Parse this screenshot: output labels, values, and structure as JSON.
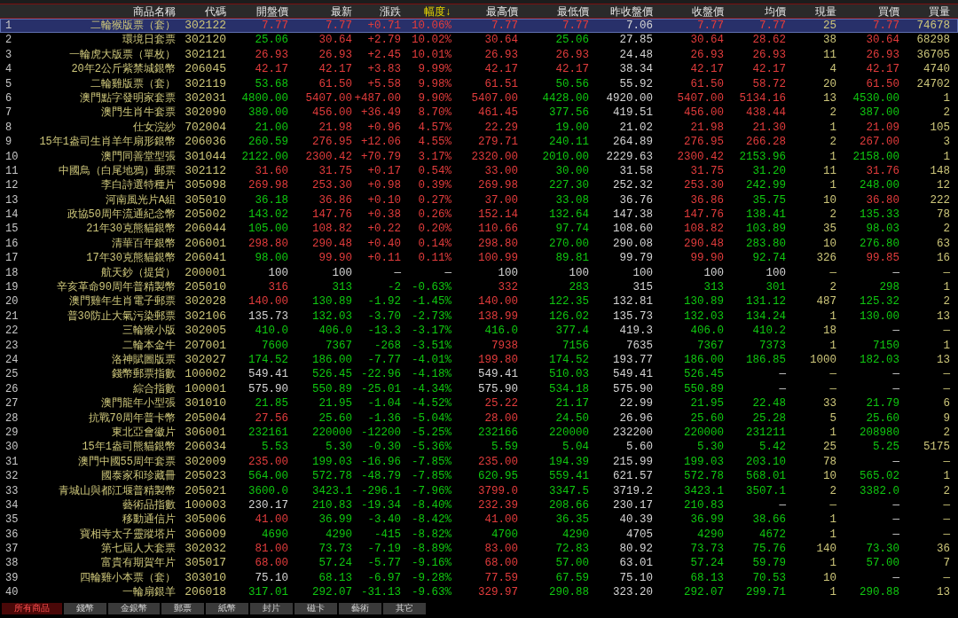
{
  "columns": [
    {
      "label": "商品名稱",
      "sorted": false
    },
    {
      "label": "代碼",
      "sorted": false
    },
    {
      "label": "開盤價",
      "sorted": false
    },
    {
      "label": "最新",
      "sorted": false
    },
    {
      "label": "漲跌",
      "sorted": false
    },
    {
      "label": "幅度↓",
      "sorted": true
    },
    {
      "label": "最高價",
      "sorted": false
    },
    {
      "label": "最低價",
      "sorted": false
    },
    {
      "label": "昨收盤價",
      "sorted": false
    },
    {
      "label": "收盤價",
      "sorted": false
    },
    {
      "label": "均價",
      "sorted": false
    },
    {
      "label": "現量",
      "sorted": false
    },
    {
      "label": "買價",
      "sorted": false
    },
    {
      "label": "買量",
      "sorted": false
    }
  ],
  "rows": [
    {
      "no": "1",
      "name": "二輪猴版票（套）",
      "code": "302122",
      "selected": true,
      "values": [
        "7.77",
        "7.77",
        "+0.71",
        "10.06%",
        "7.77",
        "7.77",
        "7.06",
        "7.77",
        "7.77",
        "25",
        "7.77",
        "74678"
      ]
    },
    {
      "no": "2",
      "name": "環境日套票",
      "code": "302120",
      "selected": false,
      "values": [
        "25.06",
        "30.64",
        "+2.79",
        "10.02%",
        "30.64",
        "25.06",
        "27.85",
        "30.64",
        "28.62",
        "38",
        "30.64",
        "68298"
      ]
    },
    {
      "no": "3",
      "name": "一輪虎大版票（單枚）",
      "code": "302121",
      "selected": false,
      "values": [
        "26.93",
        "26.93",
        "+2.45",
        "10.01%",
        "26.93",
        "26.93",
        "24.48",
        "26.93",
        "26.93",
        "11",
        "26.93",
        "36705"
      ]
    },
    {
      "no": "4",
      "name": "20年2公斤紫禁城銀幣",
      "code": "206045",
      "selected": false,
      "values": [
        "42.17",
        "42.17",
        "+3.83",
        "9.99%",
        "42.17",
        "42.17",
        "38.34",
        "42.17",
        "42.17",
        "4",
        "42.17",
        "4740"
      ]
    },
    {
      "no": "5",
      "name": "二輪雞版票（套）",
      "code": "302119",
      "selected": false,
      "values": [
        "53.68",
        "61.50",
        "+5.58",
        "9.98%",
        "61.51",
        "50.56",
        "55.92",
        "61.50",
        "58.72",
        "20",
        "61.50",
        "24702"
      ]
    },
    {
      "no": "6",
      "name": "澳門點字發明家套票",
      "code": "302031",
      "selected": false,
      "values": [
        "4800.00",
        "5407.00",
        "+487.00",
        "9.90%",
        "5407.00",
        "4428.00",
        "4920.00",
        "5407.00",
        "5134.16",
        "13",
        "4530.00",
        "1"
      ]
    },
    {
      "no": "7",
      "name": "澳門生肖牛套票",
      "code": "302090",
      "selected": false,
      "values": [
        "380.00",
        "456.00",
        "+36.49",
        "8.70%",
        "461.45",
        "377.56",
        "419.51",
        "456.00",
        "438.44",
        "2",
        "387.00",
        "2"
      ]
    },
    {
      "no": "8",
      "name": "仕女浣紗",
      "code": "702004",
      "selected": false,
      "values": [
        "21.00",
        "21.98",
        "+0.96",
        "4.57%",
        "22.29",
        "19.00",
        "21.02",
        "21.98",
        "21.30",
        "1",
        "21.09",
        "105"
      ]
    },
    {
      "no": "9",
      "name": "15年1盎司生肖羊年扇形銀幣",
      "code": "206036",
      "selected": false,
      "values": [
        "260.59",
        "276.95",
        "+12.06",
        "4.55%",
        "279.71",
        "240.11",
        "264.89",
        "276.95",
        "266.28",
        "2",
        "267.00",
        "3"
      ]
    },
    {
      "no": "10",
      "name": "澳門同善堂型張",
      "code": "301044",
      "selected": false,
      "values": [
        "2122.00",
        "2300.42",
        "+70.79",
        "3.17%",
        "2320.00",
        "2010.00",
        "2229.63",
        "2300.42",
        "2153.96",
        "1",
        "2158.00",
        "1"
      ]
    },
    {
      "no": "11",
      "name": "中國鳥（白尾地鴉）郵票",
      "code": "302112",
      "selected": false,
      "values": [
        "31.60",
        "31.75",
        "+0.17",
        "0.54%",
        "33.00",
        "30.00",
        "31.58",
        "31.75",
        "31.20",
        "11",
        "31.76",
        "148"
      ]
    },
    {
      "no": "12",
      "name": "李白詩選特種片",
      "code": "305098",
      "selected": false,
      "values": [
        "269.98",
        "253.30",
        "+0.98",
        "0.39%",
        "269.98",
        "227.30",
        "252.32",
        "253.30",
        "242.99",
        "1",
        "248.00",
        "12"
      ]
    },
    {
      "no": "13",
      "name": "河南風光片A組",
      "code": "305010",
      "selected": false,
      "values": [
        "36.18",
        "36.86",
        "+0.10",
        "0.27%",
        "37.00",
        "33.08",
        "36.76",
        "36.86",
        "35.75",
        "10",
        "36.80",
        "222"
      ]
    },
    {
      "no": "14",
      "name": "政協50周年流通紀念幣",
      "code": "205002",
      "selected": false,
      "values": [
        "143.02",
        "147.76",
        "+0.38",
        "0.26%",
        "152.14",
        "132.64",
        "147.38",
        "147.76",
        "138.41",
        "2",
        "135.33",
        "78"
      ]
    },
    {
      "no": "15",
      "name": "21年30克熊貓銀幣",
      "code": "206044",
      "selected": false,
      "values": [
        "105.00",
        "108.82",
        "+0.22",
        "0.20%",
        "110.66",
        "97.74",
        "108.60",
        "108.82",
        "103.89",
        "35",
        "98.03",
        "2"
      ]
    },
    {
      "no": "16",
      "name": "清華百年銀幣",
      "code": "206001",
      "selected": false,
      "values": [
        "298.80",
        "290.48",
        "+0.40",
        "0.14%",
        "298.80",
        "270.00",
        "290.08",
        "290.48",
        "283.80",
        "10",
        "276.80",
        "63"
      ]
    },
    {
      "no": "17",
      "name": "17年30克熊貓銀幣",
      "code": "206041",
      "selected": false,
      "values": [
        "98.00",
        "99.90",
        "+0.11",
        "0.11%",
        "100.99",
        "89.81",
        "99.79",
        "99.90",
        "92.74",
        "326",
        "99.85",
        "16"
      ]
    },
    {
      "no": "18",
      "name": "航天鈔（提貨）",
      "code": "200001",
      "selected": false,
      "values": [
        "100",
        "100",
        "—",
        "—",
        "100",
        "100",
        "100",
        "100",
        "100",
        "—",
        "—",
        "—"
      ]
    },
    {
      "no": "19",
      "name": "辛亥革命90周年普精製幣",
      "code": "205010",
      "selected": false,
      "values": [
        "316",
        "313",
        "-2",
        "-0.63%",
        "332",
        "283",
        "315",
        "313",
        "301",
        "2",
        "298",
        "1"
      ]
    },
    {
      "no": "20",
      "name": "澳門雞年生肖電子郵票",
      "code": "302028",
      "selected": false,
      "values": [
        "140.00",
        "130.89",
        "-1.92",
        "-1.45%",
        "140.00",
        "122.35",
        "132.81",
        "130.89",
        "131.12",
        "487",
        "125.32",
        "2"
      ]
    },
    {
      "no": "21",
      "name": "普30防止大氣污染郵票",
      "code": "302106",
      "selected": false,
      "values": [
        "135.73",
        "132.03",
        "-3.70",
        "-2.73%",
        "138.99",
        "126.02",
        "135.73",
        "132.03",
        "134.24",
        "1",
        "130.00",
        "13"
      ]
    },
    {
      "no": "22",
      "name": "三輪猴小版",
      "code": "302005",
      "selected": false,
      "values": [
        "410.0",
        "406.0",
        "-13.3",
        "-3.17%",
        "416.0",
        "377.4",
        "419.3",
        "406.0",
        "410.2",
        "18",
        "—",
        "—"
      ]
    },
    {
      "no": "23",
      "name": "二輪本金牛",
      "code": "207001",
      "selected": false,
      "values": [
        "7600",
        "7367",
        "-268",
        "-3.51%",
        "7938",
        "7156",
        "7635",
        "7367",
        "7373",
        "1",
        "7150",
        "1"
      ]
    },
    {
      "no": "24",
      "name": "洛神賦圖版票",
      "code": "302027",
      "selected": false,
      "values": [
        "174.52",
        "186.00",
        "-7.77",
        "-4.01%",
        "199.80",
        "174.52",
        "193.77",
        "186.00",
        "186.85",
        "1000",
        "182.03",
        "13"
      ]
    },
    {
      "no": "25",
      "name": "錢幣郵票指數",
      "code": "100002",
      "selected": false,
      "values": [
        "549.41",
        "526.45",
        "-22.96",
        "-4.18%",
        "549.41",
        "510.03",
        "549.41",
        "526.45",
        "—",
        "—",
        "—",
        "—"
      ]
    },
    {
      "no": "26",
      "name": "綜合指數",
      "code": "100001",
      "selected": false,
      "values": [
        "575.90",
        "550.89",
        "-25.01",
        "-4.34%",
        "575.90",
        "534.18",
        "575.90",
        "550.89",
        "—",
        "—",
        "—",
        "—"
      ]
    },
    {
      "no": "27",
      "name": "澳門龍年小型張",
      "code": "301010",
      "selected": false,
      "values": [
        "21.85",
        "21.95",
        "-1.04",
        "-4.52%",
        "25.22",
        "21.17",
        "22.99",
        "21.95",
        "22.48",
        "33",
        "21.79",
        "6"
      ]
    },
    {
      "no": "28",
      "name": "抗戰70周年普卡幣",
      "code": "205004",
      "selected": false,
      "values": [
        "27.56",
        "25.60",
        "-1.36",
        "-5.04%",
        "28.00",
        "24.50",
        "26.96",
        "25.60",
        "25.28",
        "5",
        "25.60",
        "9"
      ]
    },
    {
      "no": "29",
      "name": "東北亞會徽片",
      "code": "306001",
      "selected": false,
      "values": [
        "232161",
        "220000",
        "-12200",
        "-5.25%",
        "232166",
        "220000",
        "232200",
        "220000",
        "231211",
        "1",
        "208980",
        "2"
      ]
    },
    {
      "no": "30",
      "name": "15年1盎司熊貓銀幣",
      "code": "206034",
      "selected": false,
      "values": [
        "5.53",
        "5.30",
        "-0.30",
        "-5.36%",
        "5.59",
        "5.04",
        "5.60",
        "5.30",
        "5.42",
        "25",
        "5.25",
        "5175"
      ]
    },
    {
      "no": "31",
      "name": "澳門中國55周年套票",
      "code": "302009",
      "selected": false,
      "values": [
        "235.00",
        "199.03",
        "-16.96",
        "-7.85%",
        "235.00",
        "194.39",
        "215.99",
        "199.03",
        "203.10",
        "78",
        "—",
        "—"
      ]
    },
    {
      "no": "32",
      "name": "國泰家和珍藏冊",
      "code": "205023",
      "selected": false,
      "values": [
        "564.00",
        "572.78",
        "-48.79",
        "-7.85%",
        "620.95",
        "559.41",
        "621.57",
        "572.78",
        "568.01",
        "10",
        "565.02",
        "1"
      ]
    },
    {
      "no": "33",
      "name": "青城山與都江堰普精製幣",
      "code": "205021",
      "selected": false,
      "values": [
        "3600.0",
        "3423.1",
        "-296.1",
        "-7.96%",
        "3799.0",
        "3347.5",
        "3719.2",
        "3423.1",
        "3507.1",
        "2",
        "3382.0",
        "2"
      ]
    },
    {
      "no": "34",
      "name": "藝術品指數",
      "code": "100003",
      "selected": false,
      "values": [
        "230.17",
        "210.83",
        "-19.34",
        "-8.40%",
        "232.39",
        "208.66",
        "230.17",
        "210.83",
        "—",
        "—",
        "—",
        "—"
      ]
    },
    {
      "no": "35",
      "name": "移動通信片",
      "code": "305006",
      "selected": false,
      "values": [
        "41.00",
        "36.99",
        "-3.40",
        "-8.42%",
        "41.00",
        "36.35",
        "40.39",
        "36.99",
        "38.66",
        "1",
        "—",
        "—"
      ]
    },
    {
      "no": "36",
      "name": "寶相寺太子靈蹤塔片",
      "code": "306009",
      "selected": false,
      "values": [
        "4690",
        "4290",
        "-415",
        "-8.82%",
        "4700",
        "4290",
        "4705",
        "4290",
        "4672",
        "1",
        "—",
        "—"
      ]
    },
    {
      "no": "37",
      "name": "第七屆人大套票",
      "code": "302032",
      "selected": false,
      "values": [
        "81.00",
        "73.73",
        "-7.19",
        "-8.89%",
        "83.00",
        "72.83",
        "80.92",
        "73.73",
        "75.76",
        "140",
        "73.30",
        "36"
      ]
    },
    {
      "no": "38",
      "name": "富貴有期賀年片",
      "code": "305017",
      "selected": false,
      "values": [
        "68.00",
        "57.24",
        "-5.77",
        "-9.16%",
        "68.00",
        "57.00",
        "63.01",
        "57.24",
        "59.79",
        "1",
        "57.00",
        "7"
      ]
    },
    {
      "no": "39",
      "name": "四輪雞小本票（套）",
      "code": "303010",
      "selected": false,
      "values": [
        "75.10",
        "68.13",
        "-6.97",
        "-9.28%",
        "77.59",
        "67.59",
        "75.10",
        "68.13",
        "70.53",
        "10",
        "—",
        "—"
      ]
    },
    {
      "no": "40",
      "name": "一輪扇銀羊",
      "code": "206018",
      "selected": false,
      "values": [
        "317.01",
        "292.07",
        "-31.13",
        "-9.63%",
        "329.97",
        "290.88",
        "323.20",
        "292.07",
        "299.71",
        "1",
        "290.88",
        "13"
      ]
    }
  ],
  "tabs": [
    {
      "label": "所有商品",
      "selected": true
    },
    {
      "label": "錢幣",
      "selected": false
    },
    {
      "label": "金銀幣",
      "selected": false
    },
    {
      "label": "郵票",
      "selected": false
    },
    {
      "label": "紙幣",
      "selected": false
    },
    {
      "label": "封片",
      "selected": false
    },
    {
      "label": "磁卡",
      "selected": false
    },
    {
      "label": "藝術",
      "selected": false
    },
    {
      "label": "其它",
      "selected": false
    }
  ]
}
